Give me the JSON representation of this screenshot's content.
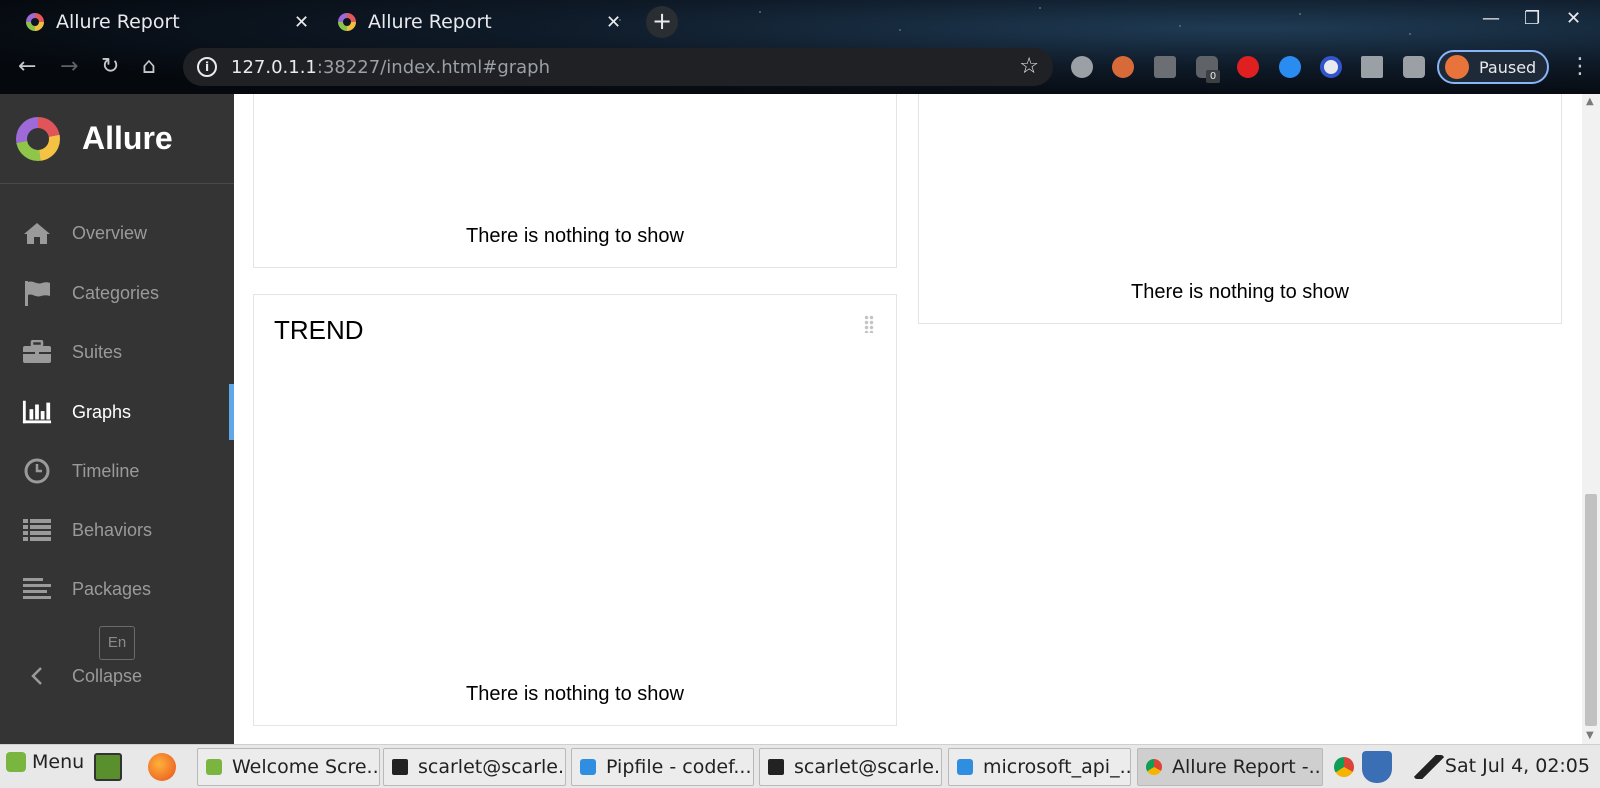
{
  "browser": {
    "tabs": [
      {
        "title": "Allure Report"
      },
      {
        "title": "Allure Report"
      }
    ],
    "url_host": "127.0.1.1",
    "url_rest": ":38227/index.html#graph",
    "profile_label": "Paused",
    "extension_badge": "0"
  },
  "sidebar": {
    "brand": "Allure",
    "items": [
      {
        "label": "Overview",
        "icon": "home-icon"
      },
      {
        "label": "Categories",
        "icon": "flag-icon"
      },
      {
        "label": "Suites",
        "icon": "briefcase-icon"
      },
      {
        "label": "Graphs",
        "icon": "bar-chart-icon",
        "active": true
      },
      {
        "label": "Timeline",
        "icon": "clock-icon"
      },
      {
        "label": "Behaviors",
        "icon": "list-icon"
      },
      {
        "label": "Packages",
        "icon": "align-left-icon"
      }
    ],
    "language": "En",
    "collapse": "Collapse"
  },
  "main": {
    "cards": [
      {
        "empty_text": "There is nothing to show"
      },
      {
        "empty_text": "There is nothing to show"
      },
      {
        "title": "TREND",
        "empty_text": "There is nothing to show"
      }
    ]
  },
  "taskbar": {
    "menu": "Menu",
    "windows": [
      {
        "label": "Welcome Scre..."
      },
      {
        "label": "scarlet@scarle..."
      },
      {
        "label": "Pipfile - codef..."
      },
      {
        "label": "scarlet@scarle..."
      },
      {
        "label": "microsoft_api_..."
      },
      {
        "label": "Allure Report -..."
      }
    ],
    "clock": "Sat Jul  4, 02:05"
  }
}
